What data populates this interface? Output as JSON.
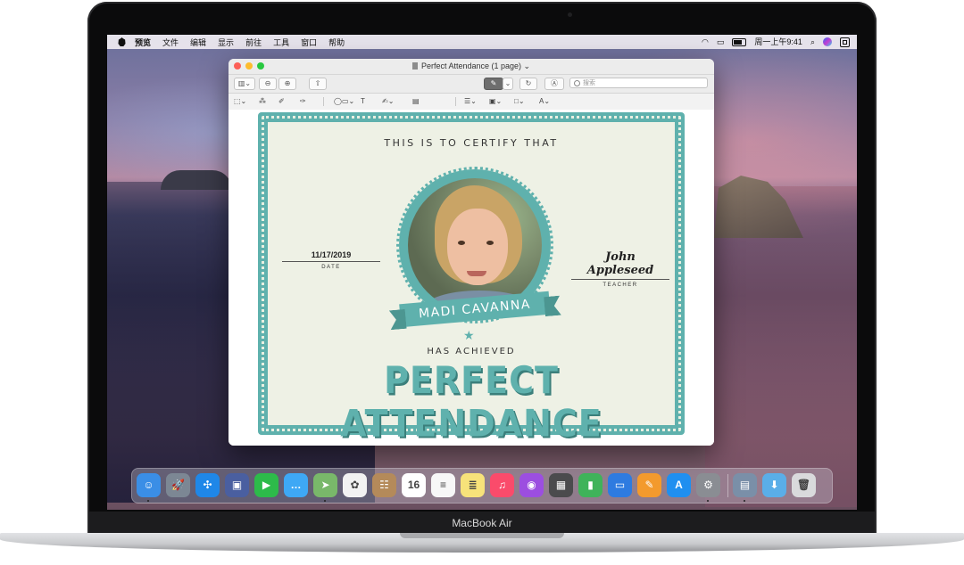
{
  "menubar": {
    "app_name": "预览",
    "menus": [
      "文件",
      "编辑",
      "显示",
      "前往",
      "工具",
      "窗口",
      "帮助"
    ],
    "clock": "周一上午9:41",
    "icons": [
      "apple-icon",
      "wifi-icon",
      "airplay-icon",
      "battery-icon",
      "search-icon",
      "siri-icon",
      "control-center-icon"
    ]
  },
  "window": {
    "title": "Perfect Attendance (1 page)",
    "search_placeholder": "搜索",
    "toolbar_icons": [
      "sidebar-icon",
      "zoom-out-icon",
      "zoom-in-icon",
      "share-icon",
      "markup-pen-icon",
      "rotate-icon",
      "annotate-icon",
      "search-icon"
    ],
    "markup_icons": [
      "selection-icon",
      "instant-alpha-icon",
      "sketch-icon",
      "draw-icon",
      "shapes-icon",
      "text-icon",
      "sign-icon",
      "note-icon",
      "shape-style-icon",
      "border-color-icon",
      "fill-color-icon",
      "text-style-icon"
    ]
  },
  "certificate": {
    "header": "THIS IS TO CERTIFY THAT",
    "name": "MADI CAVANNA",
    "date_value": "11/17/2019",
    "date_caption": "DATE",
    "teacher_value": "John Appleseed",
    "teacher_caption": "TEACHER",
    "achieved": "HAS ACHIEVED",
    "award": "PERFECT ATTENDANCE",
    "colors": {
      "accent": "#5fb1ad",
      "paper": "#eef1e5"
    }
  },
  "dock": {
    "apps": [
      {
        "name": "finder-icon",
        "color": "#3a8ee6",
        "glyph": "☺"
      },
      {
        "name": "launchpad-icon",
        "color": "#7c8794",
        "glyph": "🚀"
      },
      {
        "name": "safari-icon",
        "color": "#1f87e8",
        "glyph": "✣"
      },
      {
        "name": "photo-booth-icon",
        "color": "#4a5fa0",
        "glyph": "▣"
      },
      {
        "name": "facetime-icon",
        "color": "#2dbb4a",
        "glyph": "▶"
      },
      {
        "name": "messages-icon",
        "color": "#3ea8f5",
        "glyph": "…"
      },
      {
        "name": "maps-icon",
        "color": "#79b86a",
        "glyph": "➤"
      },
      {
        "name": "photos-icon",
        "color": "#f2f2f2",
        "glyph": "✿"
      },
      {
        "name": "contacts-icon",
        "color": "#b48a5a",
        "glyph": "☷"
      },
      {
        "name": "calendar-icon",
        "color": "#ffffff",
        "glyph": "16"
      },
      {
        "name": "reminders-icon",
        "color": "#f7f7f7",
        "glyph": "≡"
      },
      {
        "name": "notes-icon",
        "color": "#f7e27a",
        "glyph": "≣"
      },
      {
        "name": "music-icon",
        "color": "#fa4b6b",
        "glyph": "♫"
      },
      {
        "name": "podcasts-icon",
        "color": "#9c4ee0",
        "glyph": "◉"
      },
      {
        "name": "tv-icon",
        "color": "#4b4b4d",
        "glyph": "▦"
      },
      {
        "name": "numbers-icon",
        "color": "#3fb35a",
        "glyph": "▮"
      },
      {
        "name": "keynote-icon",
        "color": "#2e7be0",
        "glyph": "▭"
      },
      {
        "name": "pages-icon",
        "color": "#f39a2d",
        "glyph": "✎"
      },
      {
        "name": "app-store-icon",
        "color": "#1f8ff0",
        "glyph": "A"
      },
      {
        "name": "system-preferences-icon",
        "color": "#8a8d93",
        "glyph": "⚙"
      },
      {
        "name": "preview-icon",
        "color": "#7a8fa8",
        "glyph": "▤"
      },
      {
        "name": "downloads-folder-icon",
        "color": "#5aaee8",
        "glyph": "⬇"
      },
      {
        "name": "trash-icon",
        "color": "#d9dadc",
        "glyph": "🗑"
      }
    ]
  },
  "device": {
    "brand": "MacBook Air"
  }
}
